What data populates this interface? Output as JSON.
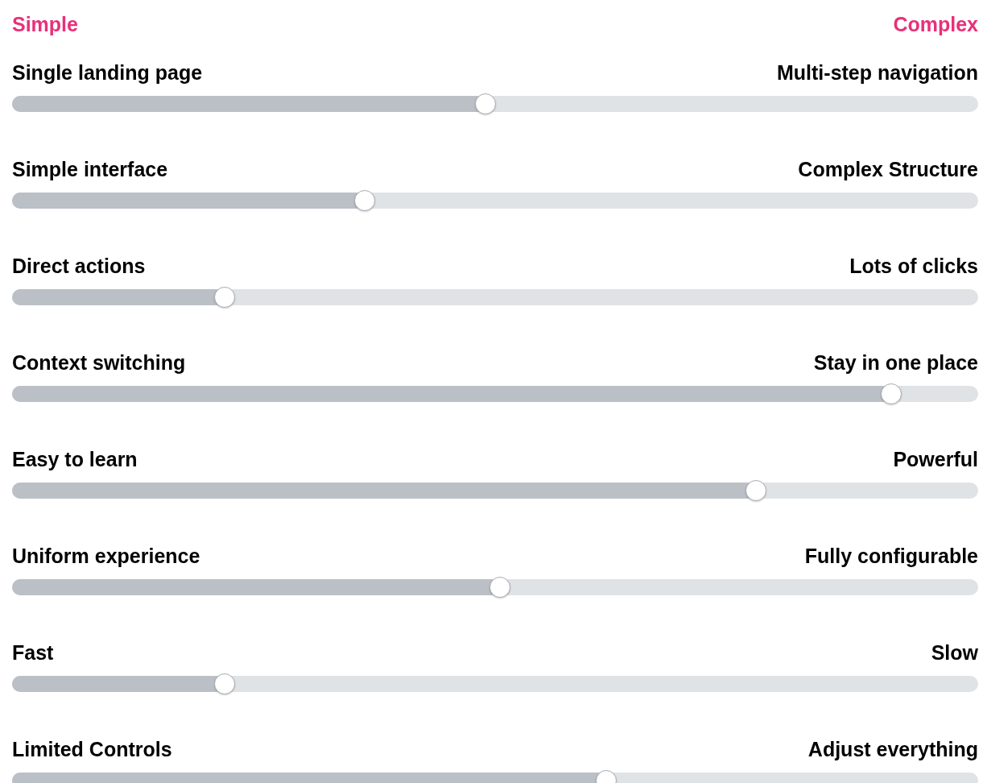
{
  "scale": {
    "left": "Simple",
    "right": "Complex"
  },
  "sliders": [
    {
      "left": "Single landing page",
      "right": "Multi-step navigation",
      "level": 0.49
    },
    {
      "left": "Simple interface",
      "right": "Complex Structure",
      "level": 0.365
    },
    {
      "left": "Direct actions",
      "right": "Lots of clicks",
      "level": 0.22
    },
    {
      "left": "Context switching",
      "right": "Stay in one place",
      "level": 0.91
    },
    {
      "left": "Easy to learn",
      "right": "Powerful",
      "level": 0.77
    },
    {
      "left": "Uniform experience",
      "right": "Fully configurable",
      "level": 0.505
    },
    {
      "left": "Fast",
      "right": "Slow",
      "level": 0.22
    },
    {
      "left": "Limited Controls",
      "right": "Adjust everything",
      "level": 0.615
    }
  ]
}
